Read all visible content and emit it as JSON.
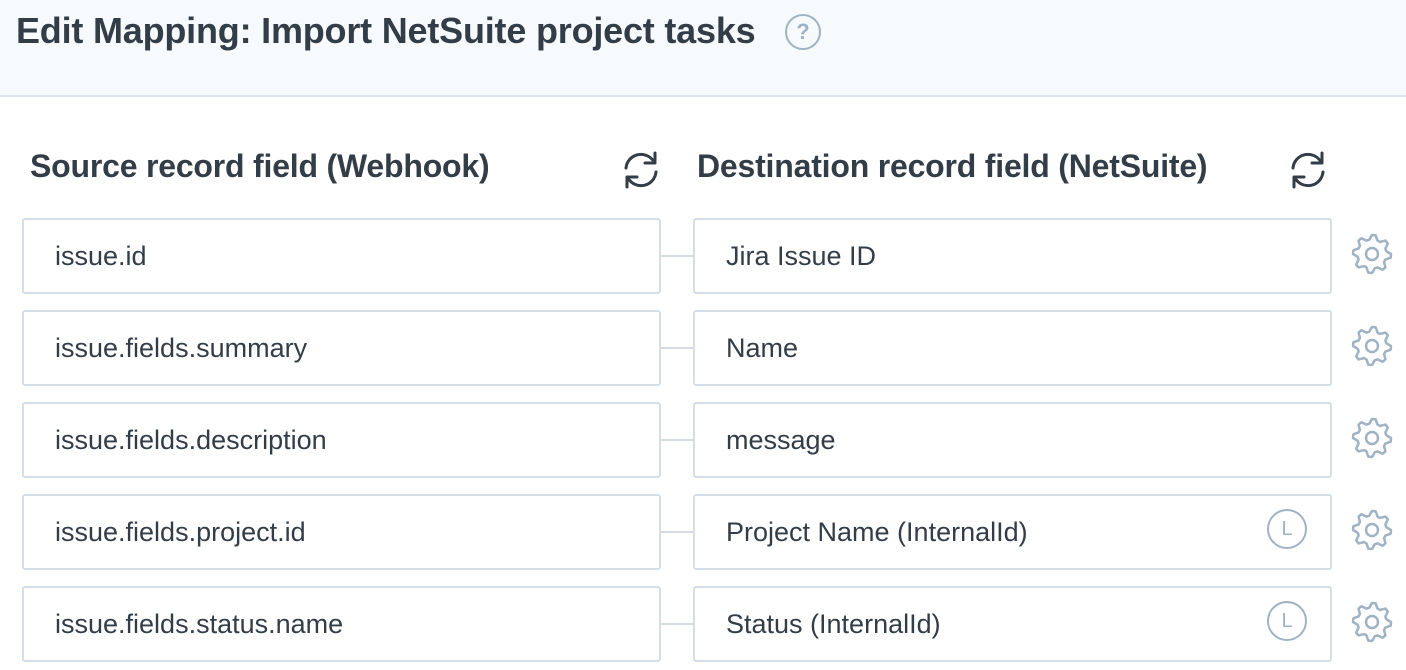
{
  "header": {
    "title": "Edit Mapping: Import NetSuite project tasks",
    "help_icon": "question-circle-icon",
    "help_glyph": "?"
  },
  "columns": {
    "source_heading": "Source record field (Webhook)",
    "destination_heading": "Destination record field (NetSuite)",
    "refresh_icon": "refresh-icon"
  },
  "colors": {
    "text": "#333d47",
    "border": "#d5dde5",
    "icon": "#9fb3c4",
    "header_bg": "#f6fafd"
  },
  "mappings": [
    {
      "source": "issue.id",
      "destination": "Jira Issue ID",
      "lookup": false
    },
    {
      "source": "issue.fields.summary",
      "destination": "Name",
      "lookup": false
    },
    {
      "source": "issue.fields.description",
      "destination": "message",
      "lookup": false
    },
    {
      "source": "issue.fields.project.id",
      "destination": "Project Name (InternalId)",
      "lookup": true,
      "lookup_glyph": "L"
    },
    {
      "source": "issue.fields.status.name",
      "destination": "Status (InternalId)",
      "lookup": true,
      "lookup_glyph": "L"
    }
  ]
}
